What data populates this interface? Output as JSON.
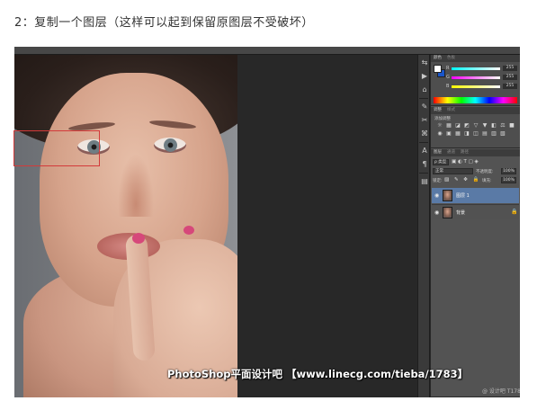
{
  "step_caption": "2：复制一个图层（这样可以起到保留原图层不受破坏）",
  "color_panel": {
    "tabs": [
      "颜色",
      "色板"
    ],
    "channels": [
      {
        "label": "R",
        "value": "255",
        "color": "#ff4040"
      },
      {
        "label": "G",
        "value": "255",
        "color": "#40d040"
      },
      {
        "label": "B",
        "value": "255",
        "color": "#4060ff"
      }
    ]
  },
  "adjust_panel": {
    "tabs": [
      "调整",
      "样式"
    ],
    "label": "添加调整",
    "icons_row1": [
      "☼",
      "▦",
      "◪",
      "◩",
      "▽",
      "▼"
    ],
    "icons_row2": [
      "◧",
      "⚖",
      "■",
      "◉",
      "▣",
      "▦"
    ],
    "icons_row3": [
      "◨",
      "◫",
      "▤",
      "▥",
      "▧"
    ]
  },
  "layers_panel": {
    "tabs": [
      "图层",
      "通道",
      "路径"
    ],
    "kind_filter": "ρ 类型",
    "filter_icons": "▣ ◐ T ▢ ◈",
    "blend_mode": "正常",
    "opacity_label": "不透明度:",
    "opacity_value": "100%",
    "lock_label": "锁定:",
    "lock_icons": "▨ ✎ ✥ 🔒",
    "fill_label": "填充:",
    "fill_value": "100%",
    "layers": [
      {
        "name": "图层 1",
        "selected": true
      },
      {
        "name": "背景",
        "selected": false
      }
    ]
  },
  "tools": [
    "⇆",
    "▶",
    "⌂",
    "✎",
    "✂",
    "⌘",
    "A",
    "¶",
    "▤"
  ],
  "watermark": "PhotoShop平面设计吧 【www.linecg.com/tieba/1783】",
  "credit": "@ 设计吧 T1783"
}
